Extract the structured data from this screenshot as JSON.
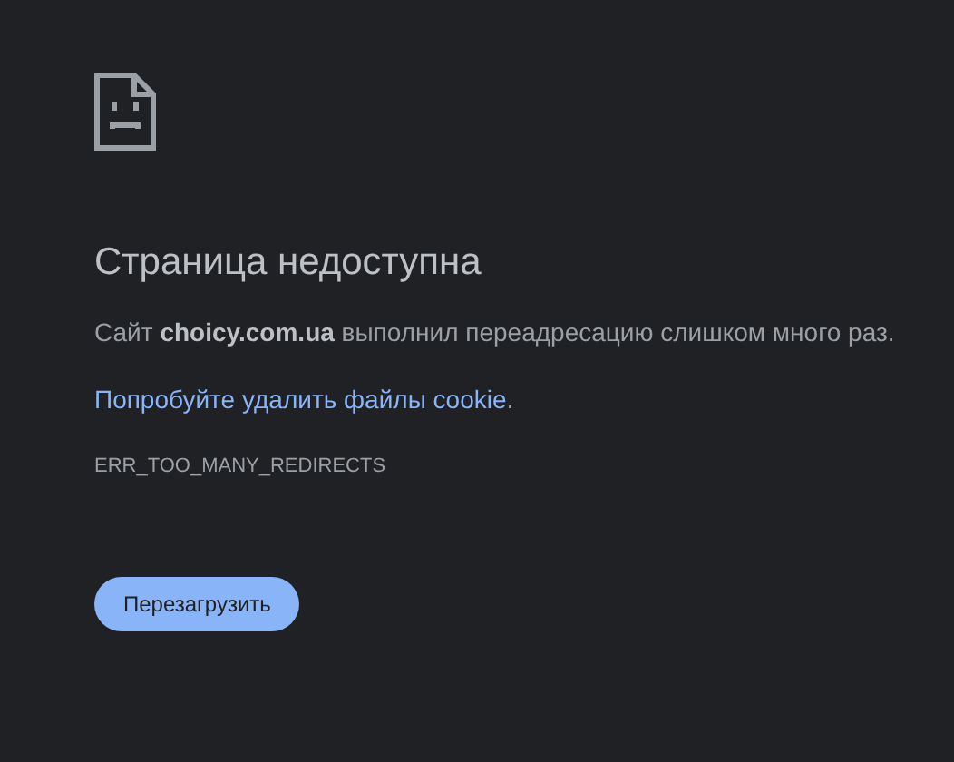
{
  "heading": "Страница недоступна",
  "message": "Сайт **choicy.com.ua** выполнил переадресацию слишком много раз.",
  "suggestion": {
    "link": "Попробуйте удалить файлы cookie",
    "after": "."
  },
  "error_code": "ERR_TOO_MANY_REDIRECTS",
  "buttons": [
    "Перезагрузить"
  ]
}
